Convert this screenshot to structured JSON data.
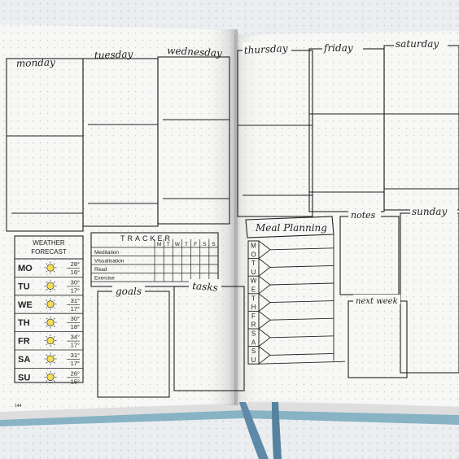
{
  "photo": {
    "days": {
      "monday": "monday",
      "tuesday": "tuesday",
      "wednesday": "wednesday",
      "thursday": "thursday",
      "friday": "friday",
      "saturday": "saturday",
      "sunday": "sunday"
    },
    "weather": {
      "title_line1": "WEATHER",
      "title_line2": "FORECAST",
      "rows": [
        {
          "day": "MO",
          "high": "28°",
          "low": "16°"
        },
        {
          "day": "TU",
          "high": "30°",
          "low": "17°"
        },
        {
          "day": "WE",
          "high": "31°",
          "low": "17°"
        },
        {
          "day": "TH",
          "high": "30°",
          "low": "18°"
        },
        {
          "day": "FR",
          "high": "34°",
          "low": "17°"
        },
        {
          "day": "SA",
          "high": "31°",
          "low": "17°"
        },
        {
          "day": "SU",
          "high": "26°",
          "low": "15°"
        }
      ],
      "sun_color": "#f3dd54"
    },
    "tracker": {
      "title": "TRACKER",
      "day_letters": [
        "M",
        "T",
        "W",
        "T",
        "F",
        "S",
        "S"
      ],
      "habits": [
        "Meditation",
        "Visualisation",
        "Read",
        "Exercise"
      ]
    },
    "goals_label": "goals",
    "tasks_label": "tasks",
    "meal_planning": {
      "title": "Meal Planning",
      "letters": [
        "M",
        "O",
        "T",
        "U",
        "W",
        "E",
        "T",
        "H",
        "F",
        "R",
        "S",
        "A",
        "S",
        "U"
      ]
    },
    "notes_label": "notes",
    "next_week_label": "next week",
    "page_number": "144",
    "colors": {
      "paper": "#f7f7f5",
      "ink": "#222222",
      "dots": "#c9c9c9",
      "ribbon": "#5f89a8",
      "cover_edge": "#87b3c5"
    }
  }
}
